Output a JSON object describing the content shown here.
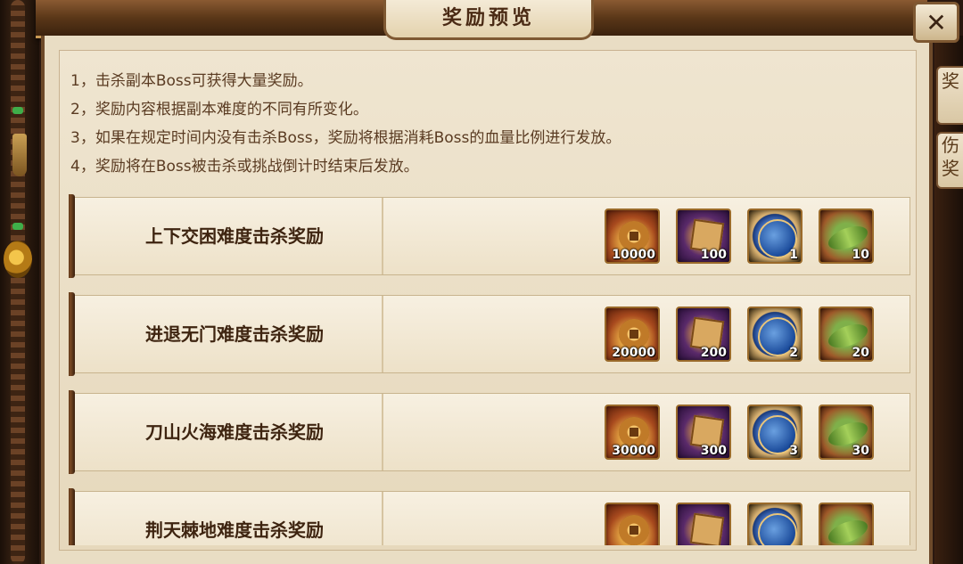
{
  "dialog": {
    "title": "奖励预览",
    "close_label": "✕",
    "side_tabs": [
      "奖",
      "伤\n奖"
    ]
  },
  "rules": [
    "1，击杀副本Boss可获得大量奖励。",
    "2，奖励内容根据副本难度的不同有所变化。",
    "3，如果在规定时间内没有击杀Boss，奖励将根据消耗Boss的血量比例进行发放。",
    "4，奖励将在Boss被击杀或挑战倒计时结束后发放。"
  ],
  "reward_rows": [
    {
      "label": "上下交困难度击杀奖励",
      "items": [
        {
          "icon": "coin-icon",
          "count": "10000"
        },
        {
          "icon": "chest-icon",
          "count": "100"
        },
        {
          "icon": "orb-icon",
          "count": "1"
        },
        {
          "icon": "herb-icon",
          "count": "10"
        }
      ]
    },
    {
      "label": "进退无门难度击杀奖励",
      "items": [
        {
          "icon": "coin-icon",
          "count": "20000"
        },
        {
          "icon": "chest-icon",
          "count": "200"
        },
        {
          "icon": "orb-icon",
          "count": "2"
        },
        {
          "icon": "herb-icon",
          "count": "20"
        }
      ]
    },
    {
      "label": "刀山火海难度击杀奖励",
      "items": [
        {
          "icon": "coin-icon",
          "count": "30000"
        },
        {
          "icon": "chest-icon",
          "count": "300"
        },
        {
          "icon": "orb-icon",
          "count": "3"
        },
        {
          "icon": "herb-icon",
          "count": "30"
        }
      ]
    },
    {
      "label": "荆天棘地难度击杀奖励",
      "items": [
        {
          "icon": "coin-icon",
          "count": ""
        },
        {
          "icon": "chest-icon",
          "count": ""
        },
        {
          "icon": "orb-icon",
          "count": ""
        },
        {
          "icon": "herb-icon",
          "count": ""
        }
      ]
    }
  ],
  "colors": {
    "frame": "#6d4a2a",
    "parchment": "#e9ddc4",
    "label_text": "#3e2410",
    "rule_text": "#5a3b22"
  }
}
